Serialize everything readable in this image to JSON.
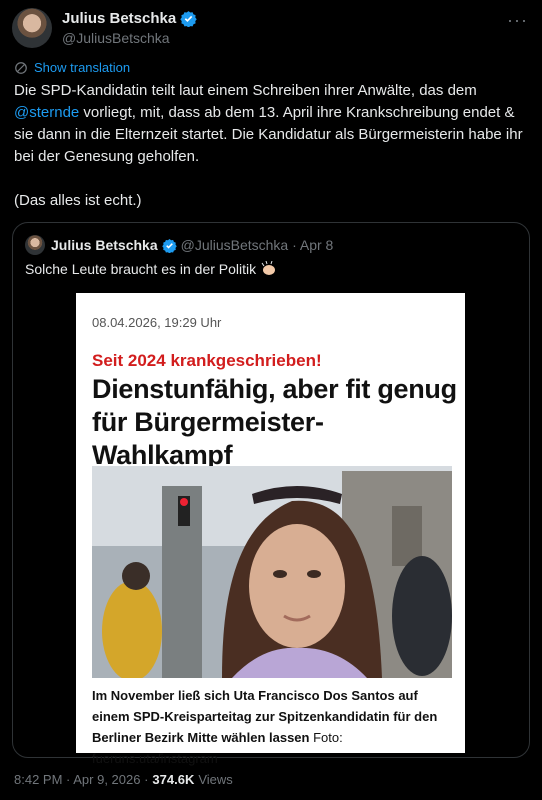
{
  "author": {
    "name": "Julius Betschka",
    "handle": "@JuliusBetschka"
  },
  "menu": {
    "more": "···"
  },
  "translate": {
    "label": "Show translation"
  },
  "tweet": {
    "text_before": "Die SPD-Kandidatin teilt laut einem Schreiben ihrer Anwälte, das dem ",
    "mention": "@sternde",
    "text_after": " vorliegt, mit, dass ab dem 13. April ihre Krankschreibung endet & sie dann in die Elternzeit startet. Die Kandidatur als Bürgermeisterin habe ihr bei der Genesung geholfen.",
    "text_second": "(Das alles ist echt.)"
  },
  "quote": {
    "name": "Julius Betschka",
    "handle_date": "@JuliusBetschka · Apr 8",
    "text": "Solche Leute braucht es in der Politik",
    "article": {
      "date": "08.04.2026, 19:29 Uhr",
      "kicker": "Seit 2024 krankgeschrieben!",
      "headline": "Dienstunfähig, aber fit genug für Bürgermeister-Wahlkampf",
      "caption_bold": "Im November ließ sich Uta Francisco Dos Santos auf einem SPD-Kreisparteitag zur Spitzenkandidatin für den Berliner Bezirk Mitte wählen lassen",
      "caption_credit": " Foto: fueruns.uta/instagram"
    }
  },
  "footer": {
    "time": "8:42 PM · Apr 9, 2026 · ",
    "views_count": "374.6K",
    "views_label": " Views"
  },
  "colors": {
    "accent": "#1d9bf0",
    "kicker": "#d21d1d",
    "background": "#000000",
    "muted": "#71767b"
  }
}
